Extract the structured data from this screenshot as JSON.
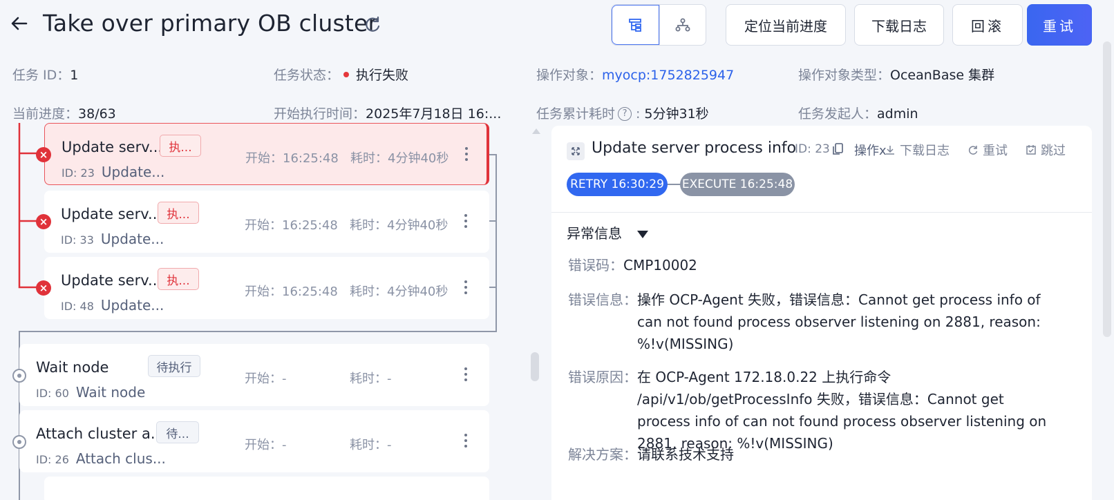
{
  "header": {
    "title": "Take over primary OB cluster",
    "buttons": {
      "locate": "定位当前进度",
      "download": "下载日志",
      "rollback": "回滚",
      "retry": "重试"
    }
  },
  "info": {
    "task_id_label": "任务 ID：",
    "task_id": "1",
    "status_label": "任务状态：",
    "status": "执行失败",
    "target_label": "操作对象：",
    "target": "myocp:1752825947",
    "target_type_label": "操作对象类型：",
    "target_type": "OceanBase 集群",
    "progress_label": "当前进度：",
    "progress": "38/63",
    "start_time_label": "开始执行时间：",
    "start_time": "2025年7月18日 16:...",
    "elapsed_label": "任务累计耗时",
    "elapsed": "5分钟31秒",
    "initiator_label": "任务发起人：",
    "initiator": "admin"
  },
  "tasks": [
    {
      "name": "Update serv...",
      "id": "ID: 23",
      "desc": "Update...",
      "status": "执...",
      "status_kind": "failed",
      "start": "开始：16:25:48",
      "elapsed": "耗时：4分钟40秒",
      "active": true
    },
    {
      "name": "Update serv...",
      "id": "ID: 33",
      "desc": "Update...",
      "status": "执...",
      "status_kind": "failed",
      "start": "开始：16:25:48",
      "elapsed": "耗时：4分钟40秒"
    },
    {
      "name": "Update serv...",
      "id": "ID: 48",
      "desc": "Update...",
      "status": "执...",
      "status_kind": "failed",
      "start": "开始：16:25:48",
      "elapsed": "耗时：4分钟40秒"
    },
    {
      "name": "Wait node",
      "id": "ID: 60",
      "desc": "Wait node",
      "status": "待执行",
      "status_kind": "pending",
      "start": "开始：-",
      "elapsed": "耗时：-"
    },
    {
      "name": "Attach cluster a...",
      "id": "ID: 26",
      "desc": "Attach clus...",
      "status": "待...",
      "status_kind": "pending",
      "start": "开始：-",
      "elapsed": "耗时：-"
    }
  ],
  "detail": {
    "title": "Update server process info",
    "id": "ID: 23",
    "actions": {
      "operate": "操作x",
      "download": "下载日志",
      "retry": "重试",
      "skip": "跳过"
    },
    "pill_retry": "RETRY 16:30:29",
    "pill_execute": "EXECUTE 16:25:48",
    "section": "异常信息",
    "error_code_label": "错误码：",
    "error_code": "CMP10002",
    "error_msg_label": "错误信息：",
    "error_msg": "操作 OCP-Agent 失败，错误信息：Cannot get process info of can not found process observer listening on 2881, reason: %!v(MISSING)",
    "error_cause_label": "错误原因：",
    "error_cause": "在 OCP-Agent 172.18.0.22 上执行命令 /api/v1/ob/getProcessInfo 失败，错误信息：Cannot get process info of can not found process observer listening on 2881, reason: %!v(MISSING)",
    "solution_label": "解决方案：",
    "solution": "请联系技术支持"
  },
  "colors": {
    "accent": "#3168f0",
    "failed": "#e0323a",
    "muted": "#7d8598"
  }
}
